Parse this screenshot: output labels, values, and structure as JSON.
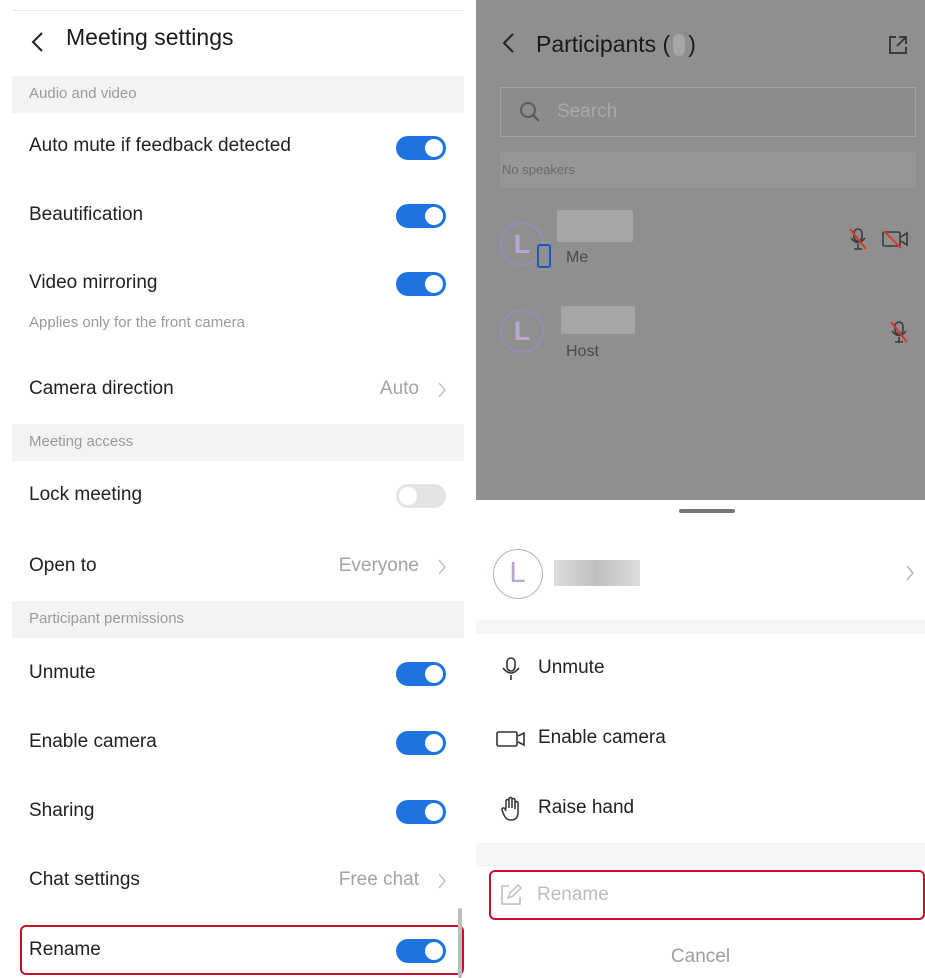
{
  "settings": {
    "title": "Meeting settings",
    "sections": {
      "audio_video": "Audio and video",
      "meeting_access": "Meeting access",
      "participant_permissions": "Participant permissions"
    },
    "items": {
      "auto_mute": {
        "label": "Auto mute if feedback detected",
        "on": true
      },
      "beautification": {
        "label": "Beautification",
        "on": true
      },
      "video_mirroring": {
        "label": "Video mirroring",
        "on": true,
        "hint": "Applies only for the front camera"
      },
      "camera_direction": {
        "label": "Camera direction",
        "value": "Auto"
      },
      "lock_meeting": {
        "label": "Lock meeting",
        "on": false
      },
      "open_to": {
        "label": "Open to",
        "value": "Everyone"
      },
      "unmute": {
        "label": "Unmute",
        "on": true
      },
      "enable_camera": {
        "label": "Enable camera",
        "on": true
      },
      "sharing": {
        "label": "Sharing",
        "on": true
      },
      "chat_settings": {
        "label": "Chat settings",
        "value": "Free chat"
      },
      "rename": {
        "label": "Rename",
        "on": true
      }
    }
  },
  "participants": {
    "title_prefix": "Participants (",
    "title_suffix": ")",
    "search_placeholder": "Search",
    "no_speakers": "No speakers",
    "list": [
      {
        "avatar_letter": "L",
        "role": "Me",
        "mic": "mic-off-icon",
        "camera": "camera-off-icon"
      },
      {
        "avatar_letter": "L",
        "role": "Host",
        "mic": "mic-off-icon"
      }
    ]
  },
  "action_sheet": {
    "avatar_letter": "L",
    "actions": {
      "unmute": "Unmute",
      "enable_camera": "Enable camera",
      "raise_hand": "Raise hand",
      "rename": "Rename"
    },
    "cancel": "Cancel"
  },
  "colors": {
    "toggle_on": "#1d74e0",
    "toggle_off": "#e3e3e3",
    "highlight_border": "#c8102e",
    "overlay": "#8f8f8f"
  }
}
